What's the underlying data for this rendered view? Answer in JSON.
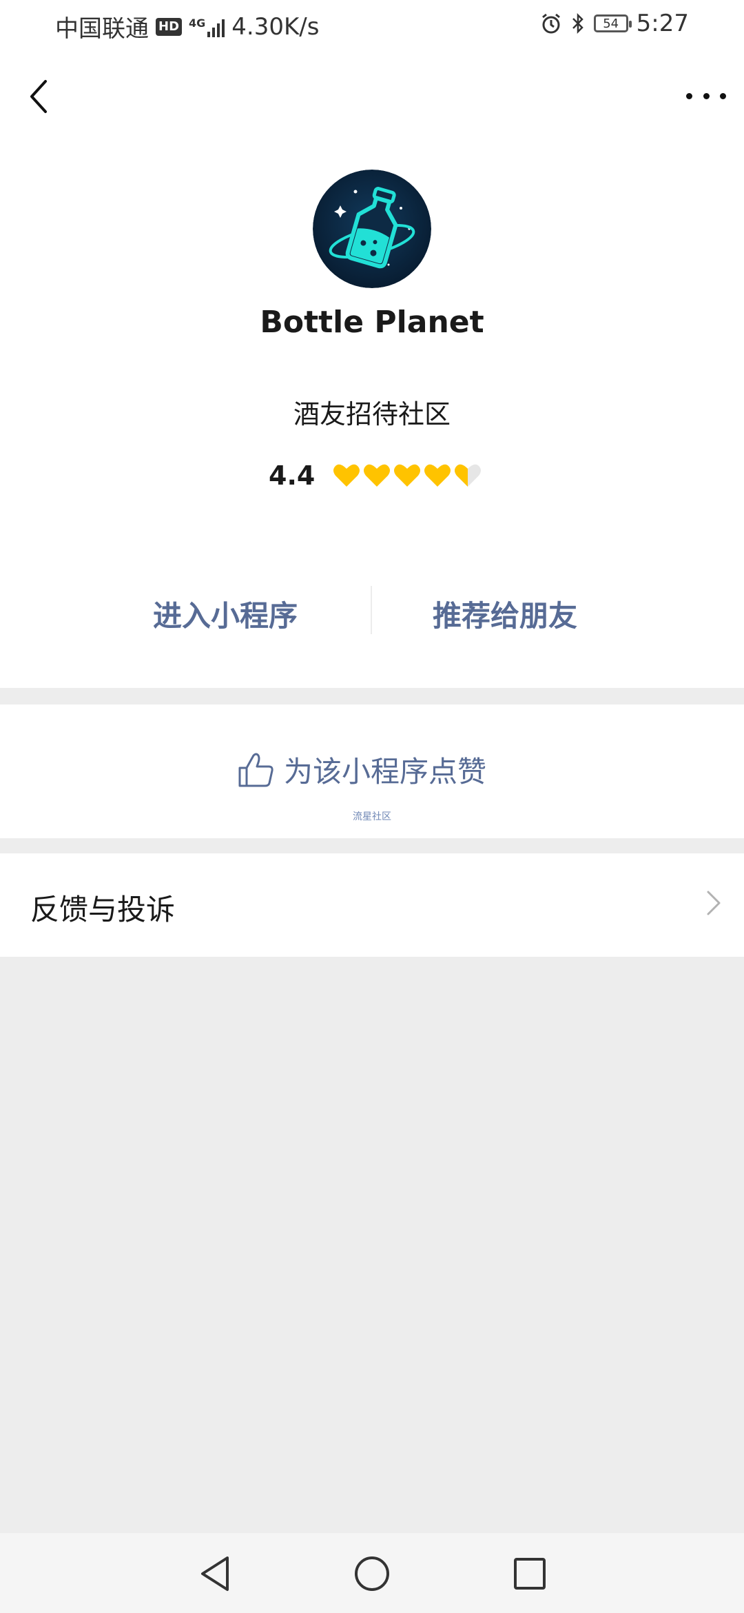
{
  "status_bar": {
    "carrier": "中国联通",
    "hd_badge": "HD",
    "network": "4G",
    "speed": "4.30K/s",
    "battery": "54",
    "time": "5:27"
  },
  "app": {
    "name": "Bottle Planet",
    "description": "酒友招待社区",
    "rating": "4.4",
    "rating_value": 4.4,
    "rating_max": 5
  },
  "actions": {
    "enter_label": "进入小程序",
    "share_label": "推荐给朋友"
  },
  "like": {
    "label": "为该小程序点赞",
    "sub_label": "流星社区"
  },
  "feedback": {
    "label": "反馈与投诉"
  },
  "colors": {
    "link_blue": "#576b95",
    "heart_yellow": "#ffc300",
    "background": "#ededed"
  }
}
